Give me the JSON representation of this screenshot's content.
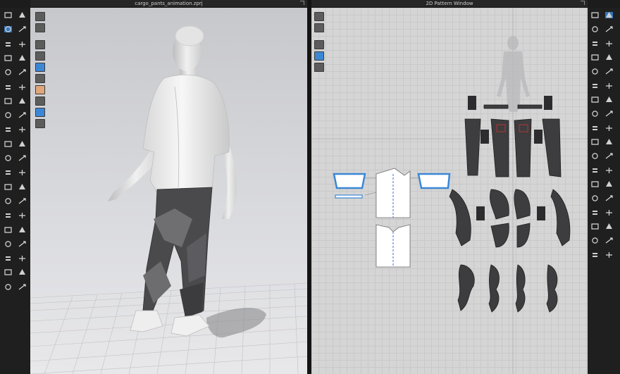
{
  "window3d": {
    "title": "cargo_pants_animation.zprj"
  },
  "window2d": {
    "title": "2D Pattern Window"
  },
  "toolbars": {
    "left_icons": [
      "arrow-down-icon",
      "walk-icon",
      "pin-icon",
      "cursor-icon",
      "move-icon",
      "transform-icon",
      "scale-icon",
      "brush-icon",
      "fold-icon",
      "tape-icon",
      "select-icon",
      "points-icon",
      "stitch-icon",
      "gizmo-icon",
      "fabric-icon",
      "cut-icon",
      "line-icon",
      "tack-icon",
      "arrange-icon",
      "button-icon",
      "zipper-icon",
      "trim-icon",
      "puckering-icon",
      "elastic-icon",
      "fit-icon",
      "hanger-icon",
      "avatar-icon",
      "pose-icon",
      "measure-icon",
      "strain-icon",
      "pressure-icon",
      "fold-arrange-icon",
      "layer-icon",
      "shirt-icon",
      "pocket-icon",
      "garment-icon",
      "sew-icon",
      "seam-icon",
      "box-icon",
      "shape-icon"
    ],
    "viewport3d_icons": [
      "display-icon",
      "camera-icon",
      "render-icon",
      "texture-icon",
      "mesh-icon",
      "avatar-display-icon",
      "skin-icon",
      "grid-icon",
      "xray-icon",
      "pin-display-icon"
    ],
    "viewport2d_icons": [
      "edit-pattern-icon",
      "grain-icon",
      "segment-icon",
      "fill-icon",
      "pattern-list-icon"
    ],
    "right_icons": [
      "transform-pattern-icon",
      "edit-point-icon",
      "curve-icon",
      "polygon-icon",
      "rectangle-icon",
      "circle-icon",
      "internal-line-icon",
      "dart-icon",
      "notch-icon",
      "seam-allowance-icon",
      "symmetry-icon",
      "unfold-icon",
      "trace-icon",
      "slash-icon",
      "fold-line-icon",
      "measure-2d-icon",
      "ruler-icon",
      "grading-icon",
      "sewing-line-icon",
      "segment-sew-icon",
      "free-sew-icon",
      "check-sew-icon",
      "sewing-pairs-icon",
      "elastic-2d-icon",
      "text-icon",
      "font-icon",
      "graphic-icon",
      "button-2d-icon",
      "buttonhole-icon",
      "zipper-2d-icon",
      "piping-icon",
      "topstitch-icon",
      "puckering-2d-icon",
      "tape-2d-icon",
      "fur-icon",
      "ribbing-icon"
    ]
  },
  "colors": {
    "accent": "#3b87d6",
    "pattern_dark": "#3b3b3b",
    "pattern_white": "#ffffff",
    "grid_bg": "#d5d5d5"
  }
}
